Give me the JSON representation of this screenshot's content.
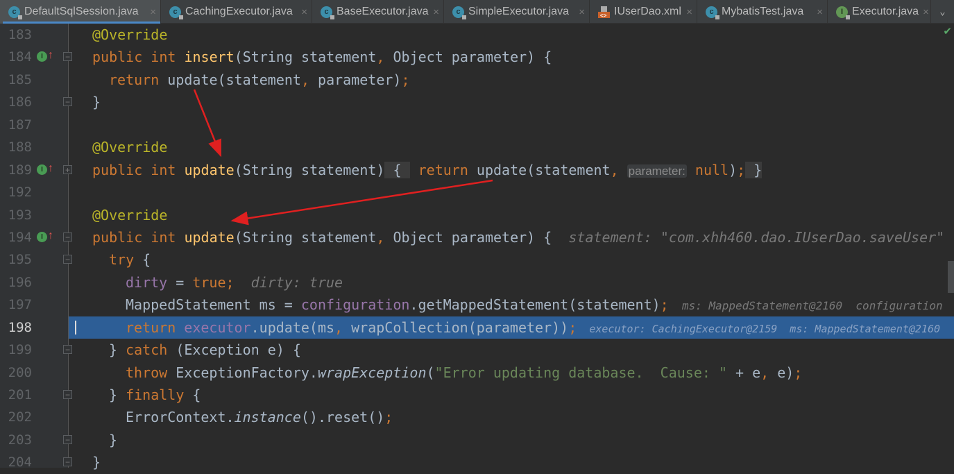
{
  "tabs": [
    {
      "label": "DefaultSqlSession.java",
      "icon": "class-icon",
      "active": true
    },
    {
      "label": "CachingExecutor.java",
      "icon": "class-icon"
    },
    {
      "label": "BaseExecutor.java",
      "icon": "class-icon"
    },
    {
      "label": "SimpleExecutor.java",
      "icon": "class-icon"
    },
    {
      "label": "IUserDao.xml",
      "icon": "xml-file-icon"
    },
    {
      "label": "MybatisTest.java",
      "icon": "class-icon"
    },
    {
      "label": "Executor.java",
      "icon": "interface-icon"
    }
  ],
  "colors": {
    "keyword": "#cc7832",
    "annotation": "#bbb529",
    "method": "#ffc66d",
    "field": "#9876aa",
    "string": "#6a8759",
    "text": "#a9b7c6",
    "selection": "#2d5e96",
    "arrow": "#e02020"
  },
  "editor": {
    "current_line": "198",
    "lines": [
      {
        "n": "183",
        "indent": 0,
        "tokens": [
          [
            "ann",
            "@Override"
          ]
        ]
      },
      {
        "n": "184",
        "indent": 0,
        "marker": true,
        "fold": "open",
        "tokens": [
          [
            "kw",
            "public int "
          ],
          [
            "fn",
            "insert"
          ],
          [
            "",
            "(String statement"
          ],
          [
            "kw",
            ", "
          ],
          [
            "",
            "Object parameter) {"
          ]
        ]
      },
      {
        "n": "185",
        "indent": 1,
        "tokens": [
          [
            "kw",
            "return "
          ],
          [
            "",
            "update(statement"
          ],
          [
            "kw",
            ", "
          ],
          [
            "",
            "parameter)"
          ],
          [
            "kw",
            ";"
          ]
        ]
      },
      {
        "n": "186",
        "indent": 0,
        "fold": "close",
        "tokens": [
          [
            "",
            "}"
          ]
        ]
      },
      {
        "n": "187",
        "indent": 0,
        "tokens": []
      },
      {
        "n": "188",
        "indent": 0,
        "tokens": [
          [
            "ann",
            "@Override"
          ]
        ]
      },
      {
        "n": "189",
        "indent": 0,
        "marker": true,
        "fold": "collapsed",
        "tokens": [
          [
            "kw",
            "public int "
          ],
          [
            "fn",
            "update"
          ],
          [
            "",
            "(String statement)"
          ],
          [
            "fb",
            " { "
          ],
          [
            "kw",
            " return "
          ],
          [
            "",
            "update(statement"
          ],
          [
            "kw",
            ", "
          ],
          [
            "ph",
            "parameter:"
          ],
          [
            "kw",
            " null"
          ],
          [
            "",
            ")"
          ],
          [
            "kw",
            ";"
          ],
          [
            "fb",
            " }"
          ]
        ]
      },
      {
        "n": "192",
        "indent": 0,
        "tokens": []
      },
      {
        "n": "193",
        "indent": 0,
        "tokens": [
          [
            "ann",
            "@Override"
          ]
        ]
      },
      {
        "n": "194",
        "indent": 0,
        "marker": true,
        "fold": "open",
        "tokens": [
          [
            "kw",
            "public int "
          ],
          [
            "fn",
            "update"
          ],
          [
            "",
            "(String statement"
          ],
          [
            "kw",
            ", "
          ],
          [
            "",
            "Object parameter) {  "
          ],
          [
            "hint",
            "statement: \"com.xhh460.dao.IUserDao.saveUser\""
          ]
        ]
      },
      {
        "n": "195",
        "indent": 1,
        "fold": "open",
        "tokens": [
          [
            "kw",
            "try "
          ],
          [
            "",
            "{"
          ]
        ]
      },
      {
        "n": "196",
        "indent": 2,
        "tokens": [
          [
            "fld",
            "dirty"
          ],
          [
            "",
            " = "
          ],
          [
            "kw",
            "true;"
          ],
          [
            "hint",
            "  dirty: true"
          ]
        ]
      },
      {
        "n": "197",
        "indent": 2,
        "tokens": [
          [
            "",
            "MappedStatement ms = "
          ],
          [
            "fld",
            "configuration"
          ],
          [
            "",
            ".getMappedStatement(statement)"
          ],
          [
            "kw",
            ";"
          ],
          [
            "hint",
            "  ms: MappedStatement@2160  configuration"
          ]
        ]
      },
      {
        "n": "198",
        "indent": 2,
        "selected": true,
        "tokens": [
          [
            "kw",
            "return "
          ],
          [
            "fld",
            "executor"
          ],
          [
            "",
            ".update(ms"
          ],
          [
            "kw",
            ", "
          ],
          [
            "",
            "wrapCollection(parameter))"
          ],
          [
            "kw",
            ";"
          ],
          [
            "hint",
            "  executor: CachingExecutor@2159  ms: MappedStatement@2160"
          ]
        ]
      },
      {
        "n": "199",
        "indent": 1,
        "fold": "open",
        "tokens": [
          [
            "",
            "} "
          ],
          [
            "kw",
            "catch "
          ],
          [
            "",
            "(Exception e) {"
          ]
        ]
      },
      {
        "n": "200",
        "indent": 2,
        "tokens": [
          [
            "kw",
            "throw "
          ],
          [
            "",
            "ExceptionFactory."
          ],
          [
            "it",
            "wrapException"
          ],
          [
            "",
            "("
          ],
          [
            "str",
            "\"Error updating database.  Cause: \""
          ],
          [
            "",
            " + e"
          ],
          [
            "kw",
            ", "
          ],
          [
            "",
            "e)"
          ],
          [
            "kw",
            ";"
          ]
        ]
      },
      {
        "n": "201",
        "indent": 1,
        "fold": "close",
        "tokens": [
          [
            "",
            "} "
          ],
          [
            "kw",
            "finally "
          ],
          [
            "",
            "{"
          ]
        ]
      },
      {
        "n": "202",
        "indent": 2,
        "tokens": [
          [
            "",
            "ErrorContext."
          ],
          [
            "it",
            "instance"
          ],
          [
            "",
            "().reset()"
          ],
          [
            "kw",
            ";"
          ]
        ]
      },
      {
        "n": "203",
        "indent": 1,
        "fold": "close",
        "tokens": [
          [
            "",
            "}"
          ]
        ]
      },
      {
        "n": "204",
        "indent": 0,
        "fold": "close",
        "tokens": [
          [
            "",
            "}"
          ]
        ]
      }
    ]
  }
}
